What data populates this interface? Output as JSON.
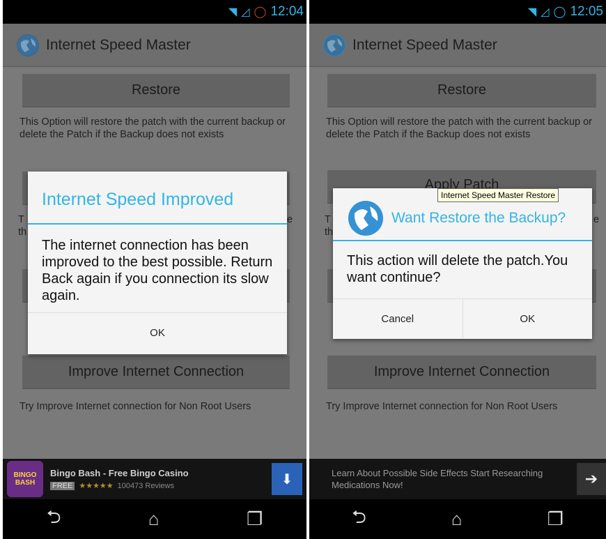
{
  "left": {
    "status": {
      "time": "12:04",
      "icons": [
        "wifi-icon",
        "signal-icon",
        "battery-icon"
      ]
    },
    "app_title": "Internet Speed Master",
    "restore_button": "Restore",
    "restore_desc": "This Option will restore the patch with the current backup or delete the Patch if the Backup does not exists",
    "improve_button": "Improve Internet Connection",
    "improve_desc": "Try Improve Internet connection for Non Root Users",
    "dialog": {
      "title": "Internet Speed Improved",
      "body": "The internet connection has been improved to the best possible. Return Back again if you connection its slow again.",
      "ok": "OK"
    },
    "ad": {
      "title": "Bingo Bash - Free Bingo Casino",
      "badge": "FREE",
      "stars": "★★★★★",
      "reviews": "100473 Reviews",
      "logo_text": "BINGO BASH"
    },
    "partial_labels": {
      "t": "T",
      "th": "th",
      "e": "e"
    }
  },
  "right": {
    "status": {
      "time": "12:05",
      "icons": [
        "wifi-icon",
        "signal-icon",
        "battery-icon"
      ]
    },
    "app_title": "Internet Speed Master",
    "restore_button": "Restore",
    "restore_desc": "This Option will restore the patch with the current backup or delete the Patch if the Backup does not exists",
    "apply_patch_partial": "Apply Patch",
    "improve_button": "Improve Internet Connection",
    "improve_desc": "Try Improve Internet connection for Non Root Users",
    "tooltip": "Internet Speed Master Restore",
    "dialog": {
      "title": "Want Restore the Backup?",
      "body": "This action will delete the patch.You want continue?",
      "cancel": "Cancel",
      "ok": "OK"
    },
    "ad": {
      "text": "Learn About Possible Side Effects Start Researching Medications Now!"
    },
    "partial_labels": {
      "t": "T",
      "th": "th",
      "e": "e"
    }
  },
  "colors": {
    "accent": "#33b5e5",
    "dim_background": "#7a7a7a",
    "ad_button": "#2a62b8"
  }
}
